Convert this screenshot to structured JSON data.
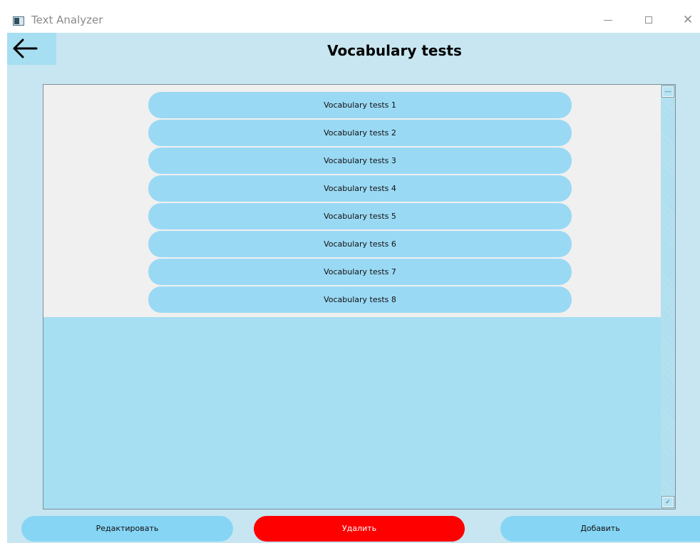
{
  "window": {
    "title": "Text Analyzer",
    "minimize_glyph": "—",
    "maximize_glyph": "☐",
    "close_glyph": "✕"
  },
  "header": {
    "title": "Vocabulary tests",
    "back_icon": "arrow-left-icon"
  },
  "list": {
    "items": [
      "Vocabulary tests 1",
      "Vocabulary tests 2",
      "Vocabulary tests 3",
      "Vocabulary tests 4",
      "Vocabulary tests 5",
      "Vocabulary tests 6",
      "Vocabulary tests 7",
      "Vocabulary tests 8"
    ]
  },
  "footer": {
    "edit_label": "Редактировать",
    "delete_label": "Удалить",
    "add_label": "Добавить"
  },
  "colors": {
    "background": "#c7e6f1",
    "list_bg": "#f0f0f0",
    "item": "#9ad9f4",
    "button": "#86d5f5",
    "delete": "#ff0000"
  }
}
